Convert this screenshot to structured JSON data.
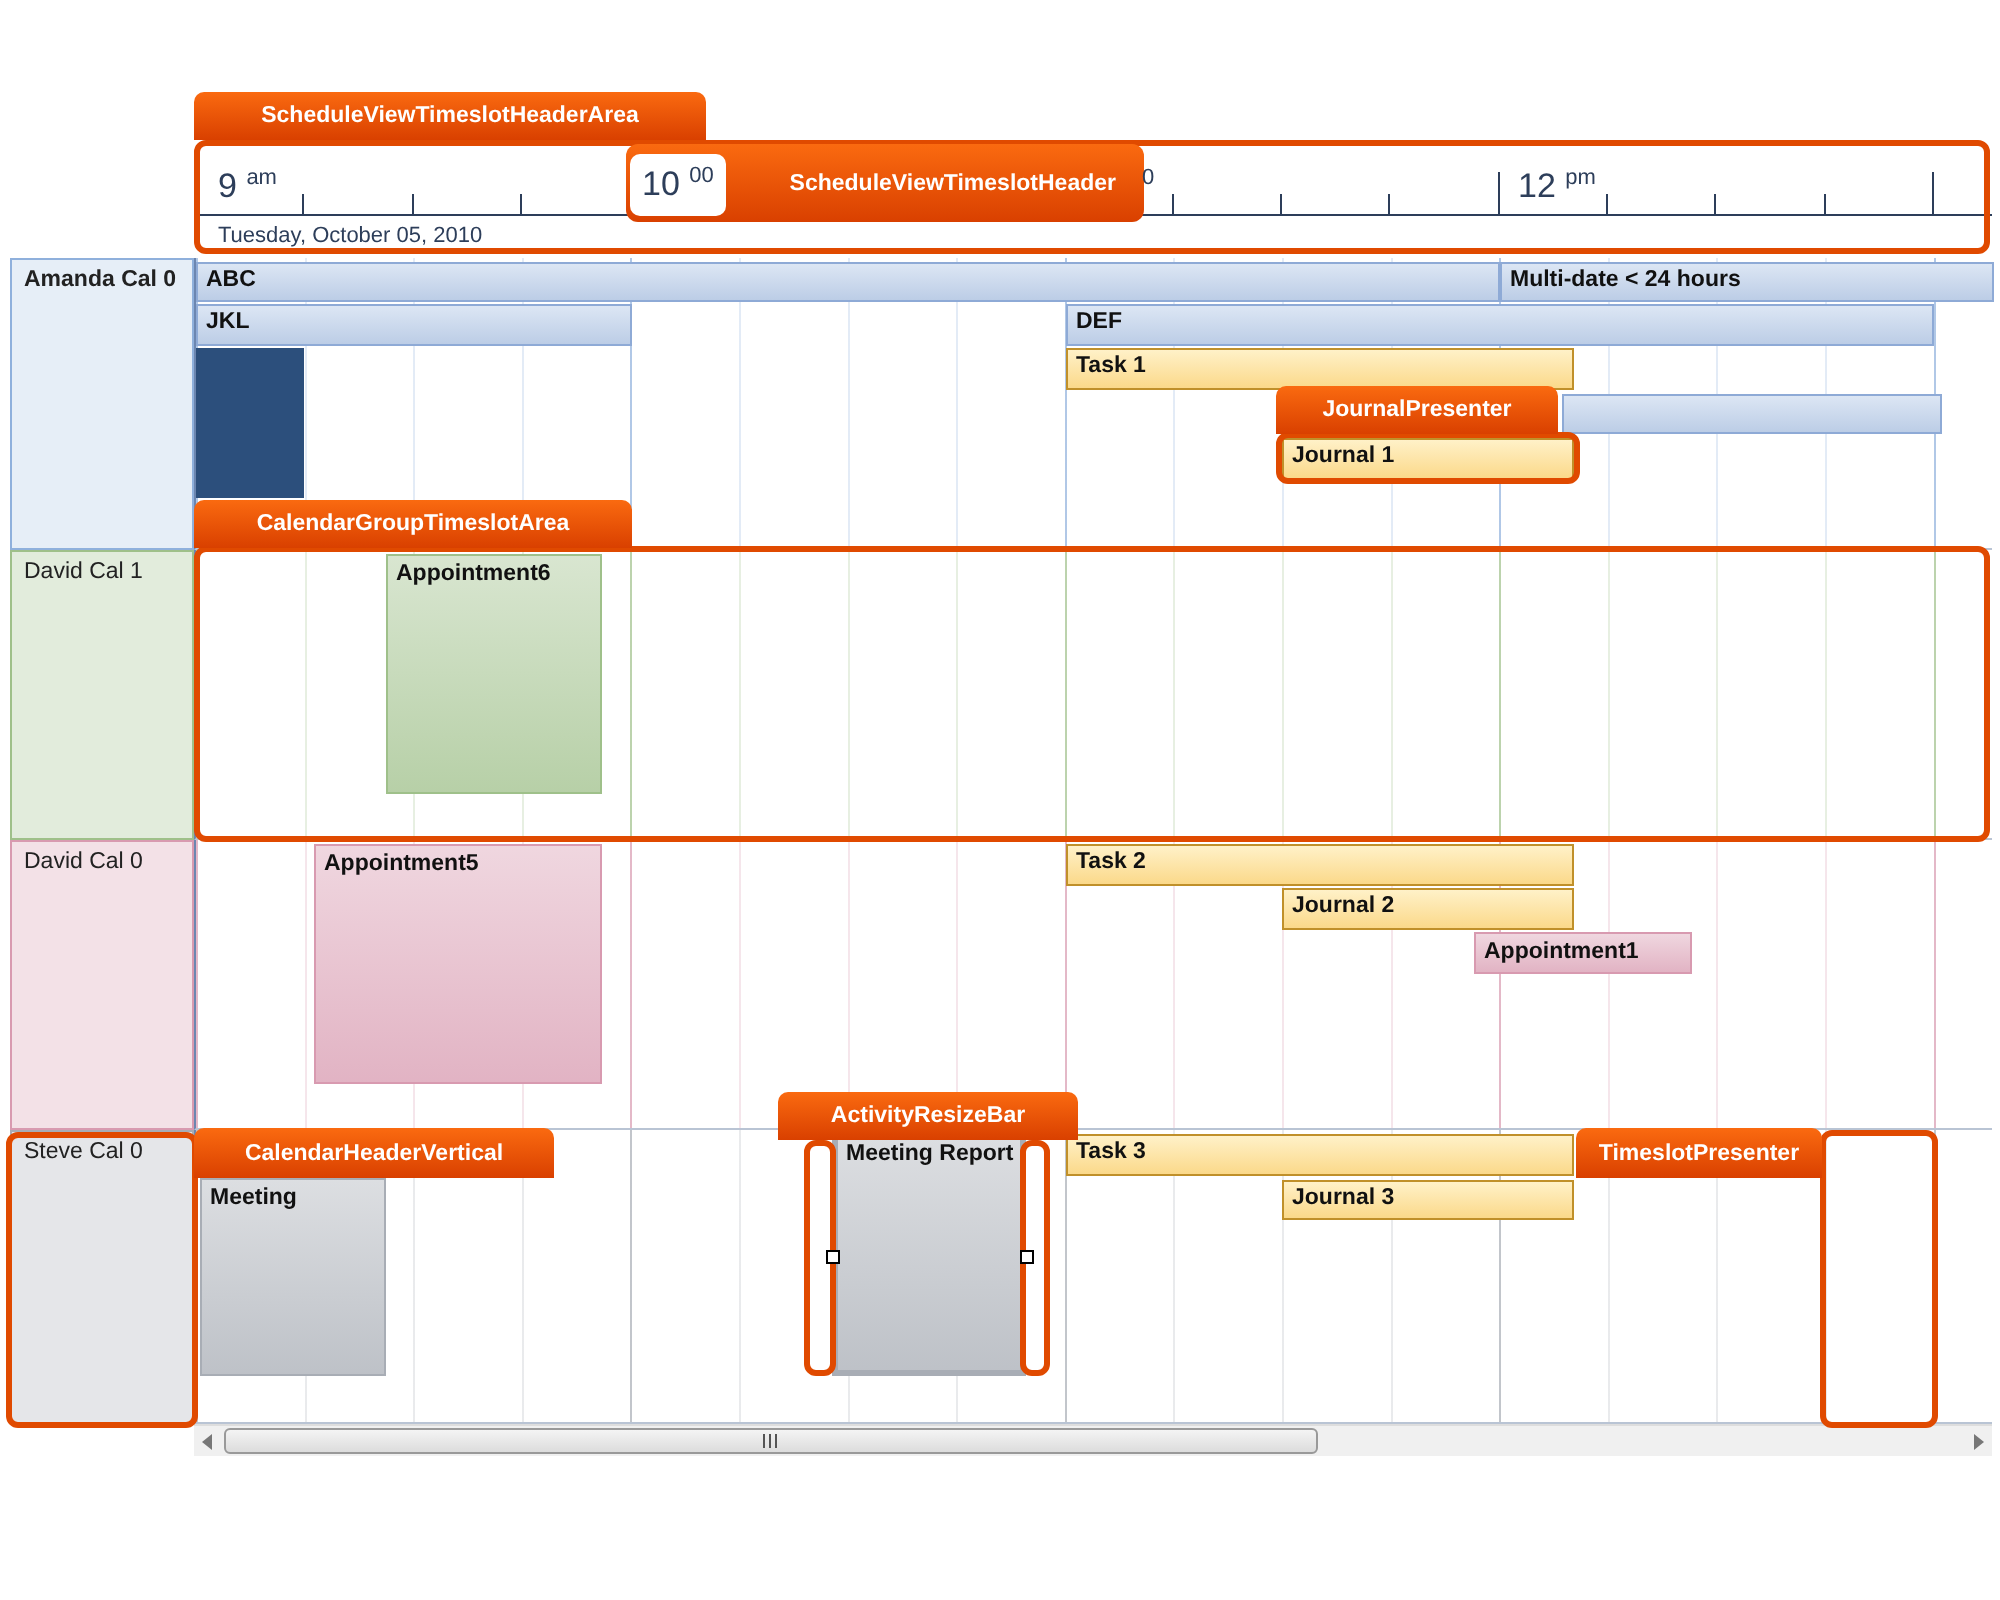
{
  "timeline_header": {
    "time_labels": [
      "9 $^{am}$",
      "10 $^{00}$",
      "$^{0}$",
      "12 $^{pm}$"
    ],
    "date": "Tuesday, October 05, 2010"
  },
  "groups": [
    {
      "name": "Amanda Cal 0",
      "selected": true,
      "color": "#8fb0dc",
      "selected_slot": true,
      "items": [
        {
          "kind": "bar",
          "title": "ABC",
          "selected": false
        },
        {
          "kind": "bar",
          "title": "Multi-date < 24 hours",
          "selected": false
        },
        {
          "kind": "bar",
          "title": "JKL",
          "selected": false
        },
        {
          "kind": "bar",
          "title": "DEF",
          "selected": false
        },
        {
          "kind": "task",
          "title": "Task 1",
          "selected": false
        },
        {
          "kind": "bar",
          "selected": false
        },
        {
          "kind": "journal",
          "title": "Journal 1",
          "selected": false
        }
      ]
    },
    {
      "name": "David Cal 1",
      "selected": false,
      "color": "#9fc08a",
      "items": [
        {
          "kind": "appointment",
          "title": "Appointment6",
          "selected": false
        }
      ]
    },
    {
      "name": "David Cal 0",
      "selected": false,
      "color": "#d89ab0",
      "items": [
        {
          "kind": "appointment",
          "title": "Appointment5",
          "selected": false
        },
        {
          "kind": "task",
          "title": "Task 2",
          "selected": false
        },
        {
          "kind": "journal",
          "title": "Journal 2",
          "selected": false
        },
        {
          "kind": "appointment",
          "title": "Appointment1",
          "selected": false
        }
      ]
    },
    {
      "name": "Steve Cal 0",
      "selected": false,
      "color": "#a8adb5",
      "items": [
        {
          "kind": "appointment",
          "title": "Meeting",
          "selected": false
        },
        {
          "kind": "appointment",
          "title": "Meeting Report",
          "selected": true
        },
        {
          "kind": "task",
          "title": "Task 3",
          "selected": false
        },
        {
          "kind": "journal",
          "title": "Journal 3",
          "selected": false
        }
      ]
    }
  ],
  "callouts": [
    {
      "label": "ScheduleViewTimeslotHeaderArea"
    },
    {
      "label": "ScheduleViewTimeslotHeader"
    },
    {
      "label": "JournalPresenter"
    },
    {
      "label": "CalendarGroupTimeslotArea"
    },
    {
      "label": "ActivityResizeBar"
    },
    {
      "label": "CalendarHeaderVertical"
    },
    {
      "label": "TimeslotPresenter"
    }
  ]
}
